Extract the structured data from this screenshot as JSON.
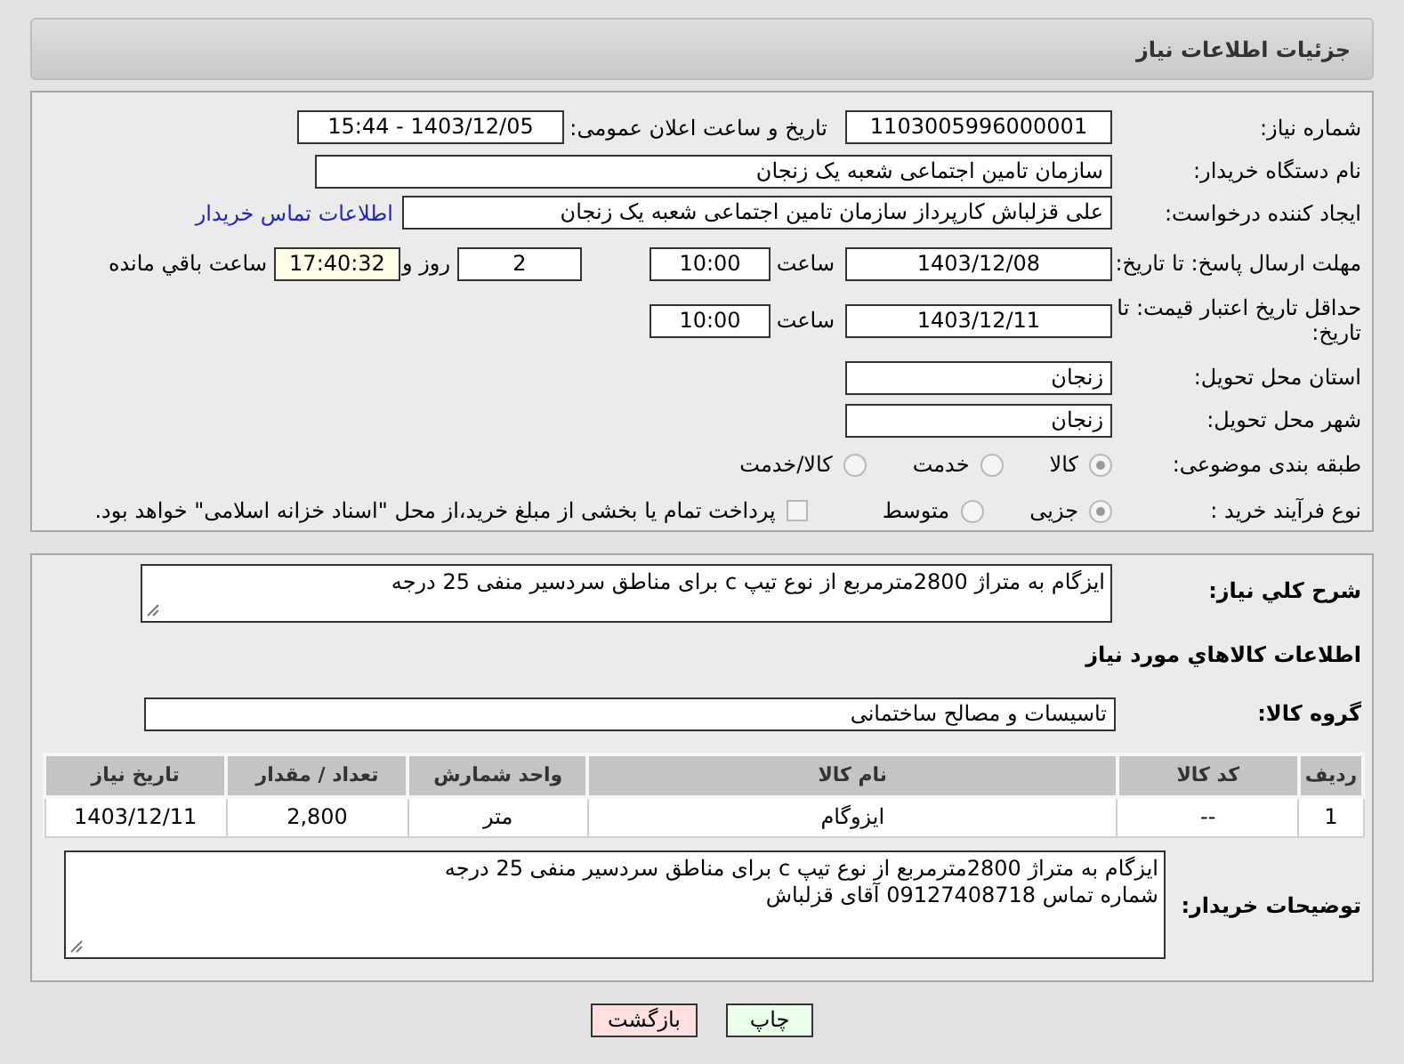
{
  "header": {
    "title": "جزئیات اطلاعات نیاز"
  },
  "need_number": {
    "label": "شماره نیاز:",
    "value": "1103005996000001"
  },
  "announce": {
    "label": "تاریخ و ساعت اعلان عمومی:",
    "value": "1403/12/05 - 15:44"
  },
  "buyer_org": {
    "label": "نام دستگاه خریدار:",
    "value": "سازمان تامین اجتماعی شعبه یک زنجان"
  },
  "requester": {
    "label": "ایجاد کننده درخواست:",
    "value": "علی قزلباش کارپرداز سازمان تامین اجتماعی شعبه یک زنجان",
    "link": "اطلاعات تماس خریدار"
  },
  "reply_deadline": {
    "label": "مهلت ارسال پاسخ: تا تاریخ:",
    "date": "1403/12/08",
    "time_label": "ساعت",
    "time": "10:00",
    "days": "2",
    "days_label": "روز و",
    "remaining": "17:40:32",
    "remaining_label": "ساعت باقي مانده"
  },
  "price_validity": {
    "label": "حداقل تاریخ اعتبار قیمت: تا تاریخ:",
    "date": "1403/12/11",
    "time_label": "ساعت",
    "time": "10:00"
  },
  "province": {
    "label": "استان محل تحویل:",
    "value": "زنجان"
  },
  "city": {
    "label": "شهر محل تحویل:",
    "value": "زنجان"
  },
  "category": {
    "label": "طبقه بندی موضوعی:",
    "options": [
      {
        "label": "کالا",
        "selected": true
      },
      {
        "label": "خدمت",
        "selected": false
      },
      {
        "label": "کالا/خدمت",
        "selected": false
      }
    ]
  },
  "process": {
    "label": "نوع فرآیند خرید :",
    "options": [
      {
        "label": "جزیی",
        "selected": true
      },
      {
        "label": "متوسط",
        "selected": false
      }
    ],
    "checkbox": {
      "label": "پرداخت تمام یا بخشی از مبلغ خرید،از محل \"اسناد خزانه اسلامی\" خواهد بود.",
      "checked": false
    }
  },
  "description": {
    "label": "شرح کلي نیاز:",
    "value": "ایزگام به متراژ 2800مترمربع از نوع تیپ c برای مناطق سردسیر منفی 25 درجه"
  },
  "goods_title": "اطلاعات كالاهاي مورد نياز",
  "goods_group": {
    "label": "گروه کالا:",
    "value": "تاسیسات و مصالح ساختمانی"
  },
  "table": {
    "columns": [
      "ردیف",
      "کد کالا",
      "نام کالا",
      "واحد شمارش",
      "تعداد / مقدار",
      "تاریخ نیاز"
    ],
    "rows": [
      [
        "1",
        "--",
        "ایزوگام",
        "متر",
        "2,800",
        "1403/12/11"
      ]
    ]
  },
  "buyer_notes": {
    "label": "توضیحات خریدار:",
    "lines": [
      "ایزگام به متراژ 2800مترمربع از نوع تیپ c برای مناطق سردسیر منفی 25 درجه",
      "شماره تماس 09127408718 آقای قزلباش"
    ]
  },
  "buttons": [
    {
      "label": "چاپ",
      "kind": "print"
    },
    {
      "label": "بازگشت",
      "kind": "back"
    }
  ]
}
